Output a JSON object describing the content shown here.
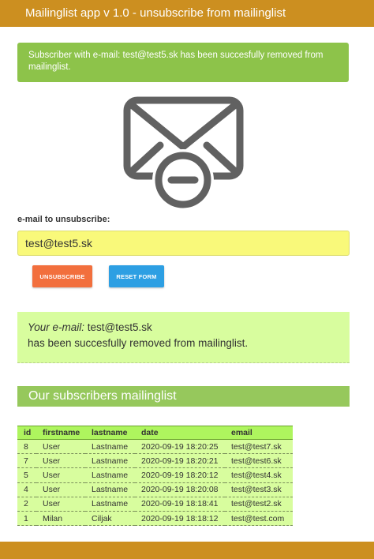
{
  "app": {
    "title": "Mailinglist app v 1.0 - unsubscribe from mailinglist"
  },
  "alert": {
    "message": "Subscriber with e-mail: test@test5.sk has been succesfully removed from mailinglist."
  },
  "form": {
    "label": "e-mail to unsubscribe:",
    "email_value": "test@test5.sk",
    "unsubscribe_label": "UNSUBSCRIBE",
    "reset_label": "RESET FORM"
  },
  "result": {
    "email_label": "Your e-mail:",
    "email": "test@test5.sk",
    "message": "has been succesfully removed from mailinglist."
  },
  "subscribers": {
    "title": "Our subscribers mailinglist",
    "columns": [
      "id",
      "firstname",
      "lastname",
      "date",
      "email"
    ],
    "rows": [
      {
        "id": "8",
        "firstname": "User",
        "lastname": "Lastname",
        "date": "2020-09-19 18:20:25",
        "email": "test@test7.sk"
      },
      {
        "id": "7",
        "firstname": "User",
        "lastname": "Lastname",
        "date": "2020-09-19 18:20:21",
        "email": "test@test6.sk"
      },
      {
        "id": "5",
        "firstname": "User",
        "lastname": "Lastname",
        "date": "2020-09-19 18:20:12",
        "email": "test@test4.sk"
      },
      {
        "id": "4",
        "firstname": "User",
        "lastname": "Lastname",
        "date": "2020-09-19 18:20:08",
        "email": "test@test3.sk"
      },
      {
        "id": "2",
        "firstname": "User",
        "lastname": "Lastname",
        "date": "2020-09-19 18:18:41",
        "email": "test@test2.sk"
      },
      {
        "id": "1",
        "firstname": "Milan",
        "lastname": "Ciljak",
        "date": "2020-09-19 18:18:12",
        "email": "test@test.com"
      }
    ]
  },
  "colors": {
    "topbar": "#cc8f20",
    "alert_success": "#8dc34a",
    "input_bg": "#f9f97a",
    "unsubscribe_button": "#f26f3d",
    "reset_button": "#2d9fe3",
    "result_bg": "#d8fd9e",
    "section_header": "#96c85c",
    "table_header": "#aef55e"
  },
  "icons": {
    "envelope": "envelope-minus-icon"
  }
}
